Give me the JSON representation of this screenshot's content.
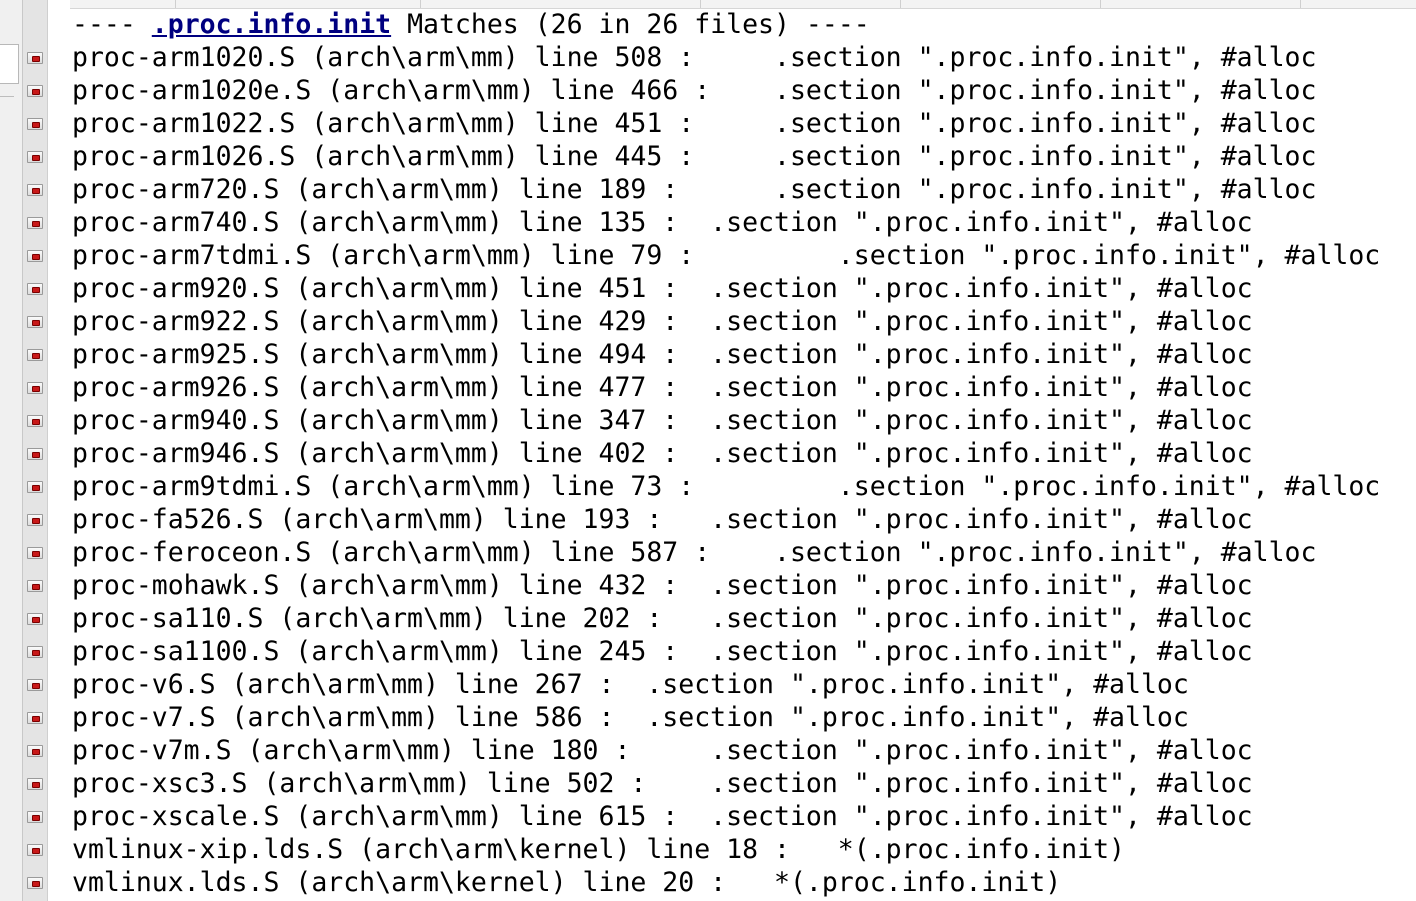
{
  "header": {
    "prefix": "---- ",
    "term": ".proc.info.init",
    "suffix": " Matches (26 in 26 files) ----"
  },
  "results": [
    "proc-arm1020.S (arch\\arm\\mm) line 508 :     .section \".proc.info.init\", #alloc",
    "proc-arm1020e.S (arch\\arm\\mm) line 466 :    .section \".proc.info.init\", #alloc",
    "proc-arm1022.S (arch\\arm\\mm) line 451 :     .section \".proc.info.init\", #alloc",
    "proc-arm1026.S (arch\\arm\\mm) line 445 :     .section \".proc.info.init\", #alloc",
    "proc-arm720.S (arch\\arm\\mm) line 189 :      .section \".proc.info.init\", #alloc",
    "proc-arm740.S (arch\\arm\\mm) line 135 :  .section \".proc.info.init\", #alloc",
    "proc-arm7tdmi.S (arch\\arm\\mm) line 79 :         .section \".proc.info.init\", #alloc",
    "proc-arm920.S (arch\\arm\\mm) line 451 :  .section \".proc.info.init\", #alloc",
    "proc-arm922.S (arch\\arm\\mm) line 429 :  .section \".proc.info.init\", #alloc",
    "proc-arm925.S (arch\\arm\\mm) line 494 :  .section \".proc.info.init\", #alloc",
    "proc-arm926.S (arch\\arm\\mm) line 477 :  .section \".proc.info.init\", #alloc",
    "proc-arm940.S (arch\\arm\\mm) line 347 :  .section \".proc.info.init\", #alloc",
    "proc-arm946.S (arch\\arm\\mm) line 402 :  .section \".proc.info.init\", #alloc",
    "proc-arm9tdmi.S (arch\\arm\\mm) line 73 :         .section \".proc.info.init\", #alloc",
    "proc-fa526.S (arch\\arm\\mm) line 193 :   .section \".proc.info.init\", #alloc",
    "proc-feroceon.S (arch\\arm\\mm) line 587 :    .section \".proc.info.init\", #alloc",
    "proc-mohawk.S (arch\\arm\\mm) line 432 :  .section \".proc.info.init\", #alloc",
    "proc-sa110.S (arch\\arm\\mm) line 202 :   .section \".proc.info.init\", #alloc",
    "proc-sa1100.S (arch\\arm\\mm) line 245 :  .section \".proc.info.init\", #alloc",
    "proc-v6.S (arch\\arm\\mm) line 267 :  .section \".proc.info.init\", #alloc",
    "proc-v7.S (arch\\arm\\mm) line 586 :  .section \".proc.info.init\", #alloc",
    "proc-v7m.S (arch\\arm\\mm) line 180 :     .section \".proc.info.init\", #alloc",
    "proc-xsc3.S (arch\\arm\\mm) line 502 :    .section \".proc.info.init\", #alloc",
    "proc-xscale.S (arch\\arm\\mm) line 615 :  .section \".proc.info.init\", #alloc",
    "vmlinux-xip.lds.S (arch\\arm\\kernel) line 18 :   *(.proc.info.init)",
    "vmlinux.lds.S (arch\\arm\\kernel) line 20 :   *(.proc.info.init)"
  ],
  "colors": {
    "header_term": "#000080",
    "marker": "#c81818"
  },
  "icons": {
    "result_marker": "bookmark-marker-icon"
  }
}
